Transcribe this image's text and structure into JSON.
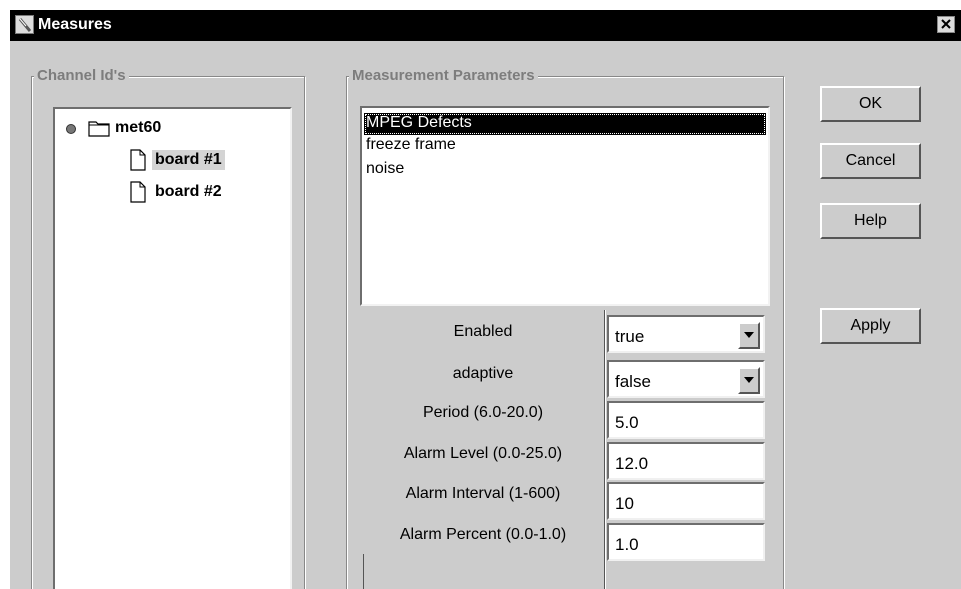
{
  "window": {
    "title": "Measures"
  },
  "channels": {
    "legend": "Channel Id's",
    "root": "met60",
    "boards": [
      {
        "label": "board #1",
        "selected": true
      },
      {
        "label": "board #2",
        "selected": false
      }
    ]
  },
  "measurement": {
    "legend": "Measurement Parameters",
    "items": [
      {
        "label": "MPEG Defects",
        "selected": true
      },
      {
        "label": "freeze frame",
        "selected": false
      },
      {
        "label": "noise",
        "selected": false
      }
    ],
    "params": [
      {
        "label": "Enabled",
        "value": "true",
        "type": "dropdown"
      },
      {
        "label": "adaptive",
        "value": "false",
        "type": "dropdown"
      },
      {
        "label": "Period (6.0-20.0)",
        "value": "5.0",
        "type": "text"
      },
      {
        "label": "Alarm Level (0.0-25.0)",
        "value": "12.0",
        "type": "text"
      },
      {
        "label": "Alarm Interval (1-600)",
        "value": "10",
        "type": "text"
      },
      {
        "label": "Alarm Percent (0.0-1.0)",
        "value": "1.0",
        "type": "text"
      }
    ]
  },
  "buttons": {
    "ok": "OK",
    "cancel": "Cancel",
    "help": "Help",
    "apply": "Apply"
  }
}
